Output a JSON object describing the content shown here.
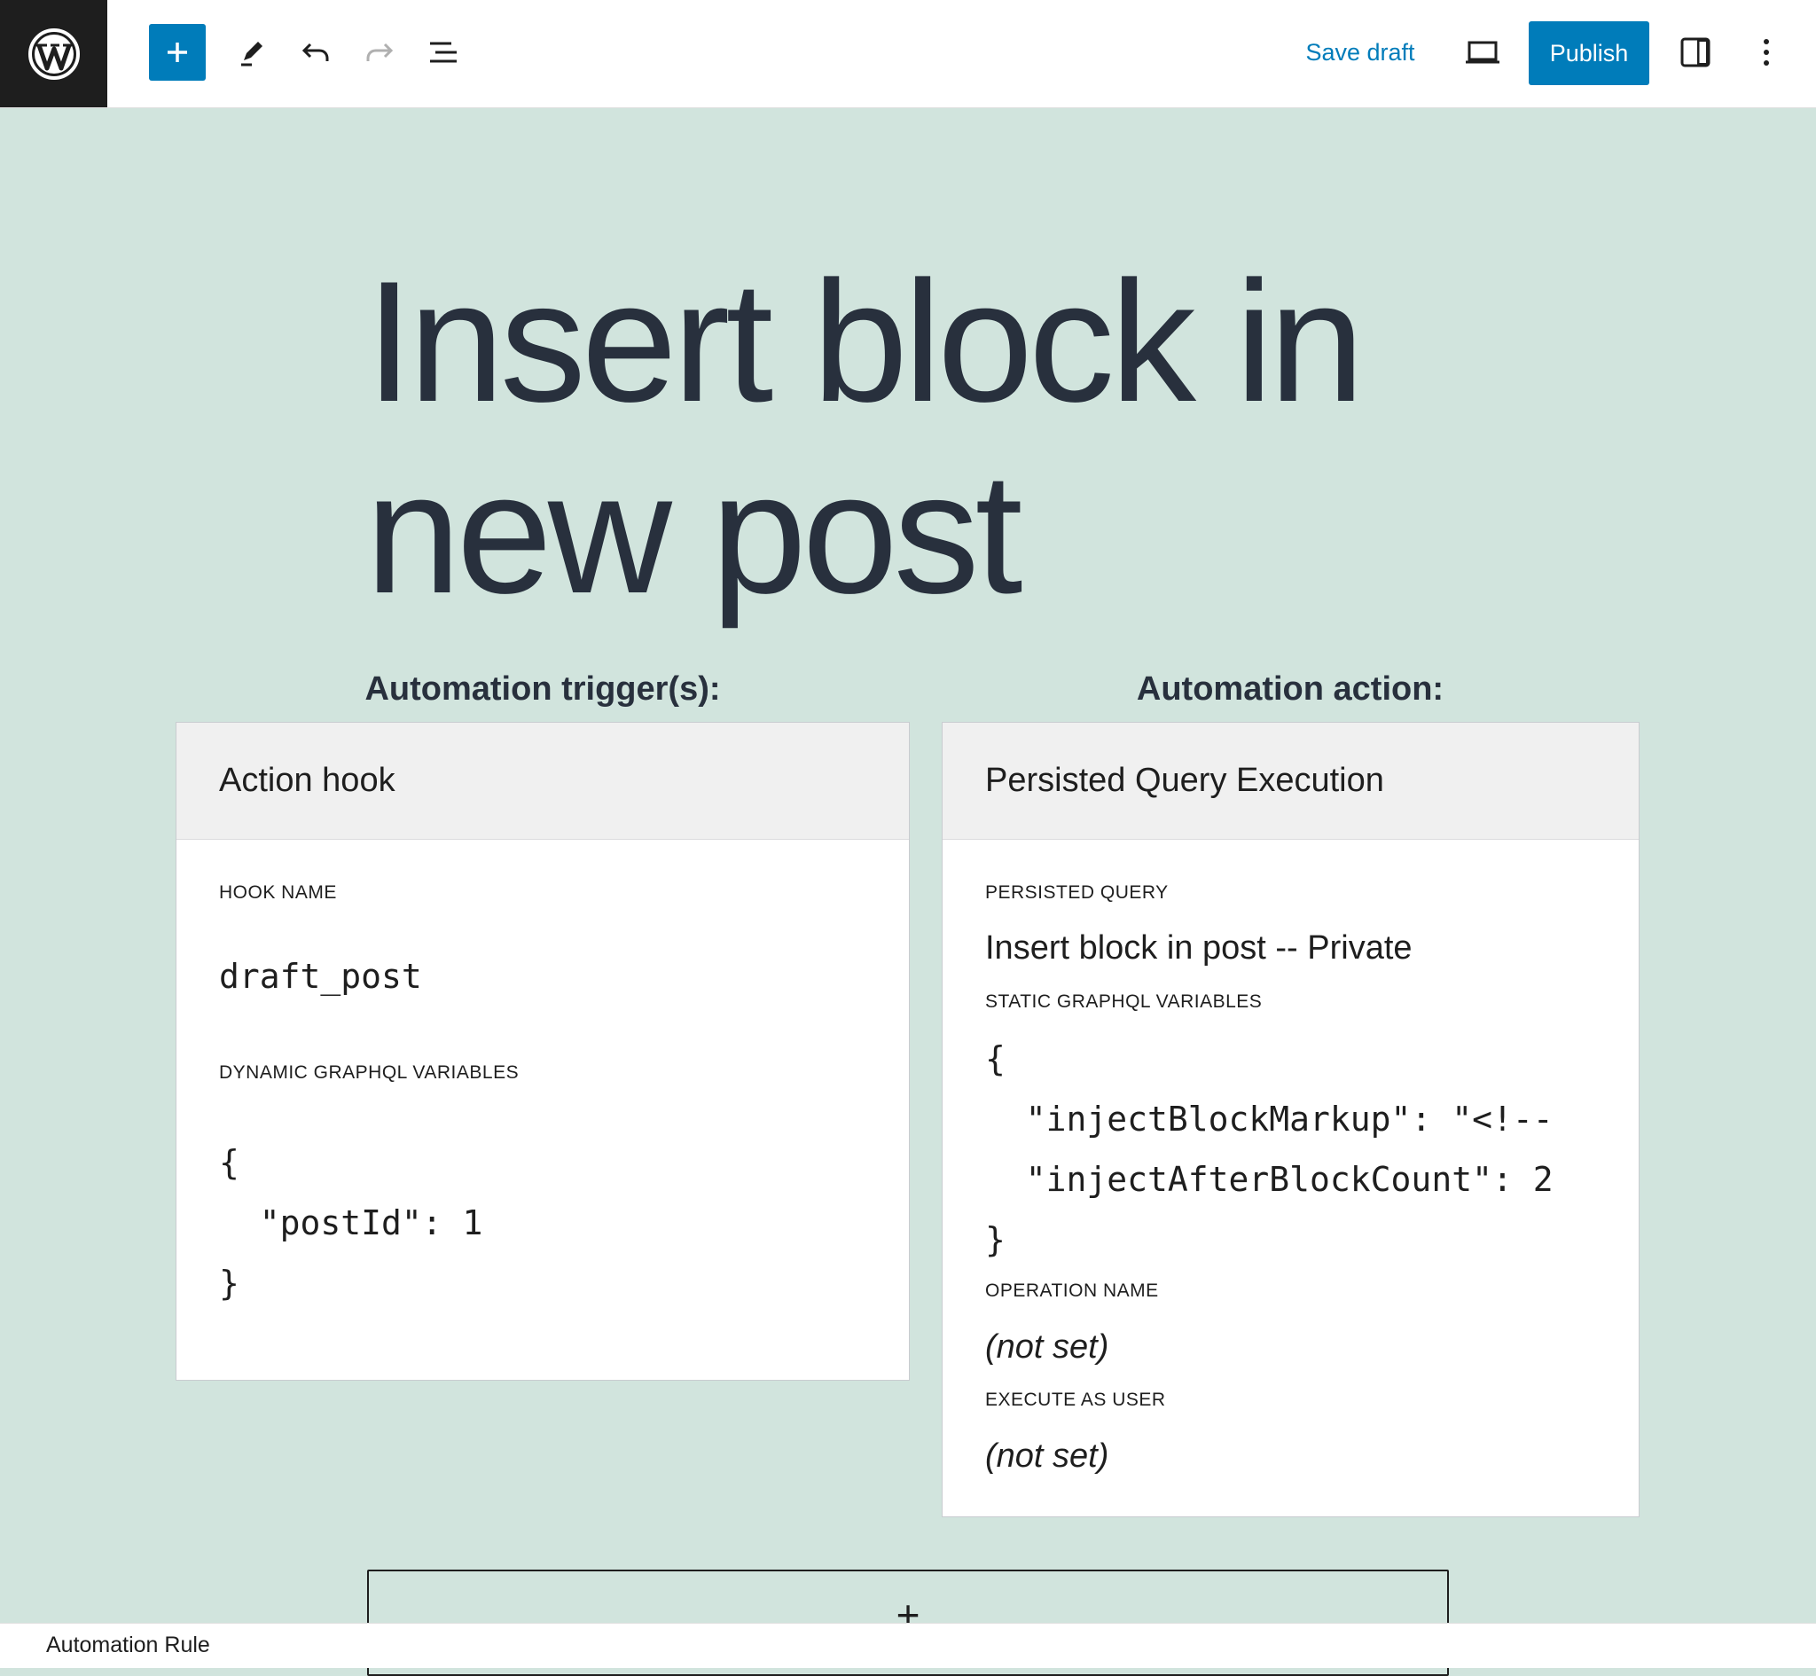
{
  "toolbar": {
    "logo_icon": "wordpress-logo-icon",
    "inserter_icon": "plus-icon",
    "tools_icon": "pencil-icon",
    "undo_icon": "undo-icon",
    "redo_icon": "redo-icon",
    "list_view_icon": "list-view-icon",
    "save_draft_label": "Save draft",
    "preview_icon": "laptop-icon",
    "publish_label": "Publish",
    "settings_icon": "sidebar-icon",
    "options_icon": "more-vertical-icon",
    "accent_color": "#007cba"
  },
  "post": {
    "title": "Insert block in new post"
  },
  "trigger": {
    "heading": "Automation trigger(s):",
    "card_title": "Action hook",
    "hook_name_label": "HOOK NAME",
    "hook_name_value": "draft_post",
    "dynamic_vars_label": "DYNAMIC GRAPHQL VARIABLES",
    "dynamic_vars_value": "{\n  \"postId\": 1\n}"
  },
  "action": {
    "heading": "Automation action:",
    "card_title": "Persisted Query Execution",
    "persisted_query_label": "PERSISTED QUERY",
    "persisted_query_value": "Insert block in post -- Private",
    "static_vars_label": "STATIC GRAPHQL VARIABLES",
    "static_vars_value": "{\n  \"injectBlockMarkup\": \"<!--\n  \"injectAfterBlockCount\": 2\n}",
    "operation_name_label": "OPERATION NAME",
    "operation_name_value": "(not set)",
    "execute_as_user_label": "EXECUTE AS USER",
    "execute_as_user_value": "(not set)"
  },
  "appender": {
    "icon": "plus-icon",
    "symbol": "+"
  },
  "footer": {
    "breadcrumb": "Automation Rule"
  },
  "colors": {
    "background": "#d1e4dd",
    "text": "#28303d"
  }
}
